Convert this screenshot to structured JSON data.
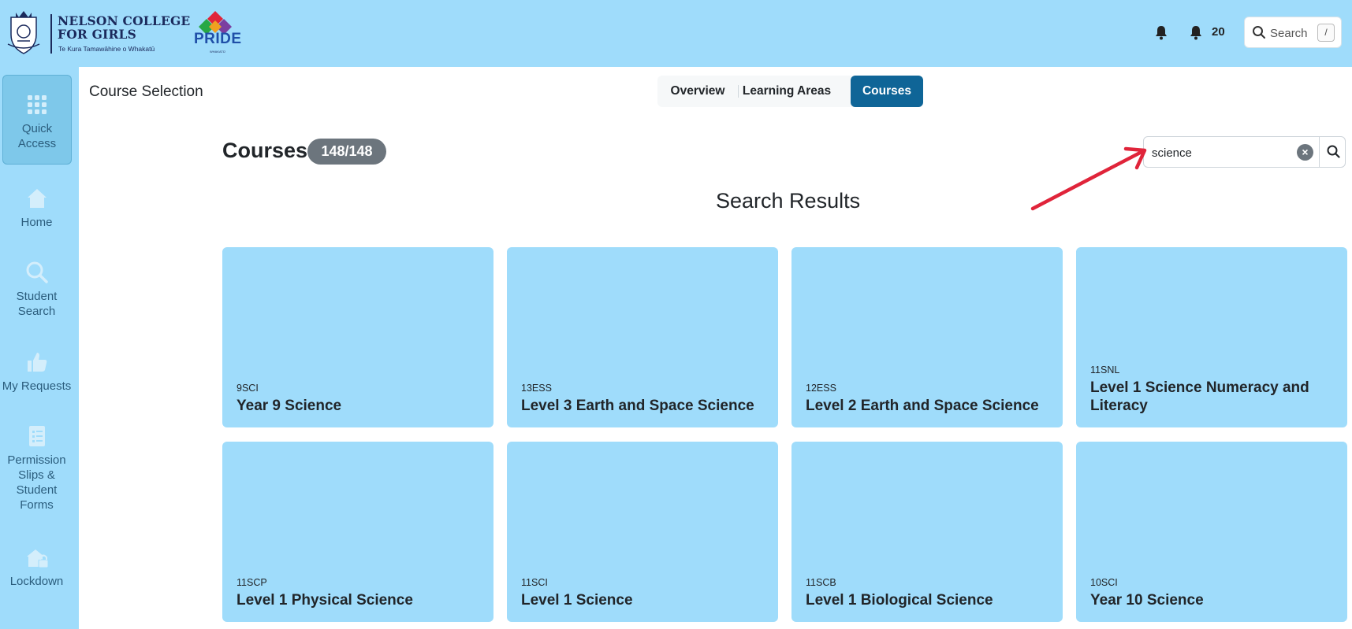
{
  "header": {
    "school_name_line1": "NELSON COLLEGE",
    "school_name_line2": "FOR GIRLS",
    "school_subtitle": "Te Kura Tamawāhine o Whakatū",
    "pride_logo_text": "PRIDE",
    "pride_logo_sub": "WHAKATŪ",
    "notification_count": "20",
    "search_label": "Search",
    "search_shortcut": "/"
  },
  "sidebar": {
    "items": [
      {
        "label": "Quick Access",
        "icon": "grid-icon",
        "active": true
      },
      {
        "label": "Home",
        "icon": "home-icon"
      },
      {
        "label": "Student Search",
        "icon": "search-icon"
      },
      {
        "label": "My Requests",
        "icon": "thumbs-up-icon"
      },
      {
        "label": "Permission Slips & Student Forms",
        "icon": "form-icon"
      },
      {
        "label": "Lockdown",
        "icon": "lockdown-icon"
      }
    ]
  },
  "main": {
    "page_title": "Course Selection",
    "tabs": [
      {
        "label": "Overview"
      },
      {
        "label": "Learning Areas"
      },
      {
        "label": "Courses",
        "active": true
      }
    ],
    "heading": "Courses",
    "count_badge": "148/148",
    "search_value": "science",
    "results_heading": "Search Results",
    "courses": [
      {
        "code": "9SCI",
        "name": "Year 9 Science"
      },
      {
        "code": "13ESS",
        "name": "Level 3 Earth and Space Science"
      },
      {
        "code": "12ESS",
        "name": "Level 2 Earth and Space Science"
      },
      {
        "code": "11SNL",
        "name": "Level 1 Science Numeracy and Literacy"
      },
      {
        "code": "11SCP",
        "name": "Level 1 Physical Science"
      },
      {
        "code": "11SCI",
        "name": "Level 1 Science"
      },
      {
        "code": "11SCB",
        "name": "Level 1 Biological Science"
      },
      {
        "code": "10SCI",
        "name": "Year 10 Science"
      }
    ]
  },
  "colors": {
    "brand_light_blue": "#9fdcfb",
    "active_tab": "#0f6597",
    "badge_grey": "#6c757d",
    "annotation_arrow": "#e0243a"
  }
}
